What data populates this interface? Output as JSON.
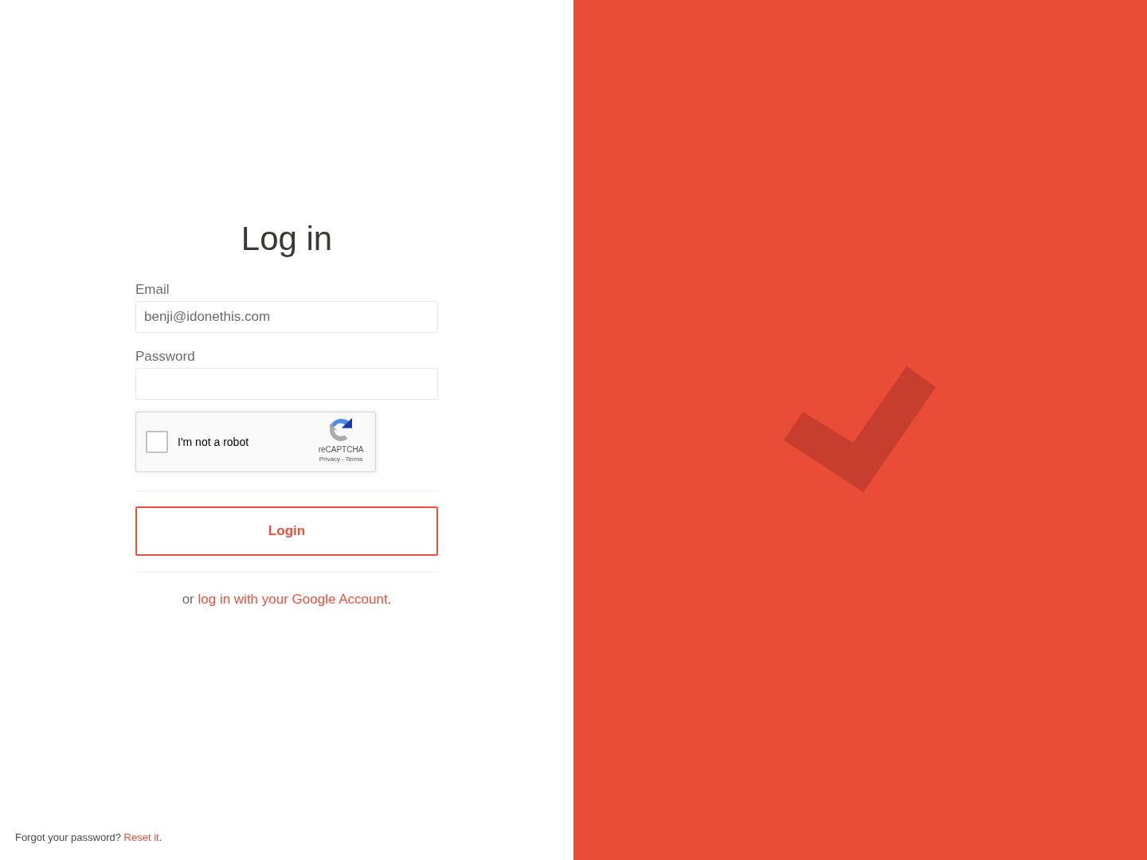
{
  "login_form": {
    "title": "Log in",
    "fields": [
      {
        "label": "Email",
        "value": "benji@idonethis.com"
      },
      {
        "label": "Password"
      }
    ],
    "captcha": {
      "label": "I'm not a robot",
      "checked": false,
      "brand": "reCAPTCHA",
      "links": [
        "Privacy",
        "Terms"
      ],
      "separator": "-"
    },
    "submit_button": "Login",
    "alternative": {
      "prefix": "or",
      "link": "log in with your Google Account",
      "suffix": "."
    }
  },
  "forgot_password": {
    "text": "Forgot your password?",
    "link": "Reset it",
    "suffix": "."
  }
}
